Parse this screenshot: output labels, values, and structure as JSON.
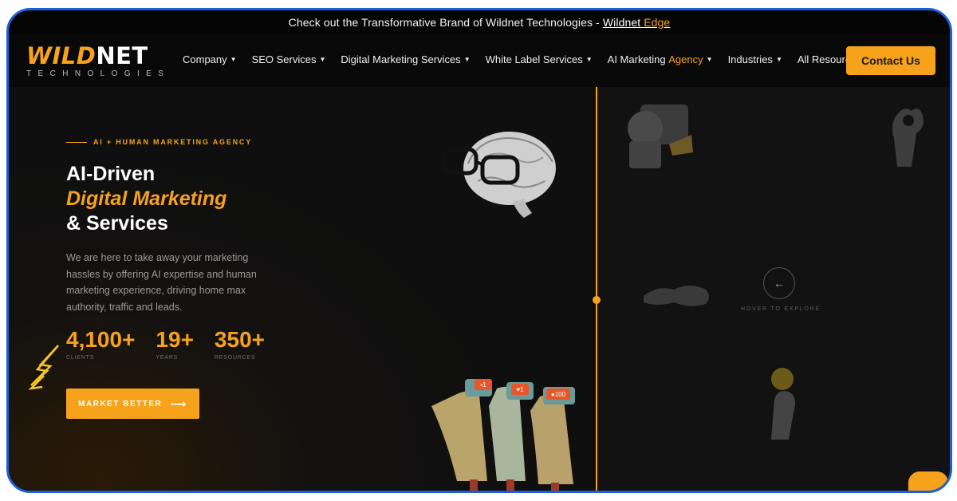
{
  "announcement": {
    "text": "Check out the Transformative Brand of Wildnet Technologies -",
    "link_main": "Wildnet",
    "link_accent": "Edge"
  },
  "logo": {
    "wild": "WILD",
    "net": "NET",
    "sub": "TECHNOLOGIES"
  },
  "nav": {
    "items": [
      {
        "label": "Company"
      },
      {
        "label": "SEO Services"
      },
      {
        "label": "Digital Marketing Services"
      },
      {
        "label": "White Label Services"
      },
      {
        "label_plain": "AI Marketing",
        "label_highlight": "Agency"
      },
      {
        "label": "Industries"
      },
      {
        "label": "All Resources"
      }
    ],
    "contact": "Contact Us"
  },
  "hero": {
    "eyebrow": "AI + HUMAN MARKETING AGENCY",
    "title_line1": "AI-Driven",
    "title_line2": "Digital Marketing",
    "title_line3": "& Services",
    "description": "We are here to take away your marketing hassles by offering AI expertise and human marketing experience, driving home max authority, traffic and leads.",
    "stats": [
      {
        "value": "4,100+",
        "label": "CLIENTS"
      },
      {
        "value": "19+",
        "label": "YEARS"
      },
      {
        "value": "350+",
        "label": "RESOURCES"
      }
    ],
    "cta": "MARKET BETTER",
    "cta_icon": "arrow-right-icon"
  },
  "explore": {
    "label": "HOVER TO EXPLORE",
    "icon": "arrow-left-icon"
  },
  "notifications": {
    "badge1": "1",
    "badge2": "1",
    "badge3": "100"
  },
  "colors": {
    "accent": "#f7a21b",
    "background": "#0c0c0c",
    "frame": "#1e5fd6"
  }
}
